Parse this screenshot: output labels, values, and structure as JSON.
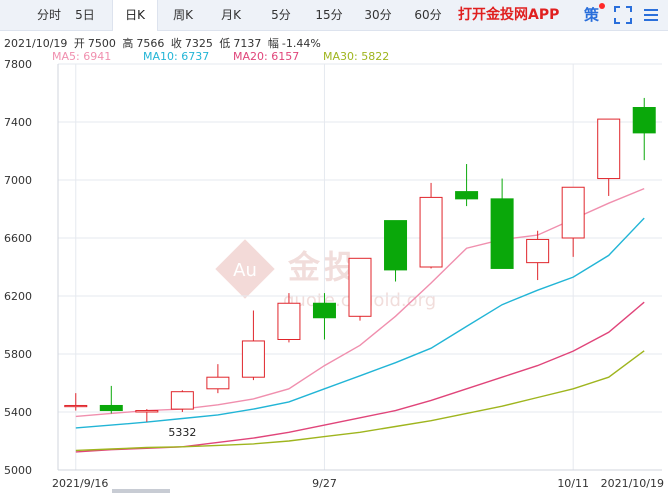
{
  "tabs": [
    {
      "label": "分时",
      "active": false
    },
    {
      "label": "5日",
      "active": false
    },
    {
      "label": "日K",
      "active": true
    },
    {
      "label": "周K",
      "active": false
    },
    {
      "label": "月K",
      "active": false
    },
    {
      "label": "5分",
      "active": false
    },
    {
      "label": "15分",
      "active": false
    },
    {
      "label": "30分",
      "active": false
    },
    {
      "label": "60分",
      "active": false
    }
  ],
  "app_link": "打开金投网APP",
  "strategy_icon_text": "策",
  "info": {
    "date": "2021/10/19",
    "open_label": "开",
    "open": "7500",
    "high_label": "高",
    "high": "7566",
    "close_label": "收",
    "close": "7325",
    "low_label": "低",
    "low": "7137",
    "change_label": "幅",
    "change": "-1.44%"
  },
  "ma_labels": [
    {
      "text": "MA5: 6941",
      "color": "#f08fae"
    },
    {
      "text": "MA10: 6737",
      "color": "#22b5d6"
    },
    {
      "text": "MA20: 6157",
      "color": "#e0457a"
    },
    {
      "text": "MA30: 5822",
      "color": "#9fb51e"
    }
  ],
  "watermark": {
    "brand": "金投",
    "logo_text": "Au",
    "url": "quote.cngold.org"
  },
  "colors": {
    "up": "#e0252b",
    "down": "#0aa80a",
    "grid": "#e6e9ef"
  },
  "chart_data": {
    "type": "candlestick",
    "ylim": [
      5000,
      7800
    ],
    "yticks": [
      5000,
      5400,
      5800,
      6200,
      6600,
      7000,
      7400,
      7800
    ],
    "xtick_labels": [
      {
        "index": 0,
        "label": "2021/9/16"
      },
      {
        "index": 7,
        "label": "9/27"
      },
      {
        "index": 14,
        "label": "10/11"
      },
      {
        "index": 21,
        "label": "2021/10/19"
      }
    ],
    "annotations": [
      {
        "index": 3,
        "value": 5332,
        "label": "5332",
        "position": "below"
      },
      {
        "index": 22,
        "value": 7566,
        "label": "7566",
        "position": "above"
      }
    ],
    "candles": [
      {
        "open": 5440,
        "high": 5530,
        "low": 5410,
        "close": 5445
      },
      {
        "open": 5445,
        "high": 5580,
        "low": 5390,
        "close": 5410
      },
      {
        "open": 5400,
        "high": 5420,
        "low": 5332,
        "close": 5410
      },
      {
        "open": 5420,
        "high": 5550,
        "low": 5400,
        "close": 5540
      },
      {
        "open": 5560,
        "high": 5730,
        "low": 5530,
        "close": 5640
      },
      {
        "open": 5640,
        "high": 6100,
        "low": 5620,
        "close": 5890
      },
      {
        "open": 5900,
        "high": 6220,
        "low": 5880,
        "close": 6150
      },
      {
        "open": 6150,
        "high": 6220,
        "low": 5900,
        "close": 6050
      },
      {
        "open": 6060,
        "high": 6460,
        "low": 6030,
        "close": 6460
      },
      {
        "open": 6720,
        "high": 6720,
        "low": 6300,
        "close": 6380
      },
      {
        "open": 6400,
        "high": 6980,
        "low": 6390,
        "close": 6880
      },
      {
        "open": 6920,
        "high": 7110,
        "low": 6820,
        "close": 6870
      },
      {
        "open": 6870,
        "high": 7010,
        "low": 6390,
        "close": 6390
      },
      {
        "open": 6430,
        "high": 6650,
        "low": 6310,
        "close": 6590
      },
      {
        "open": 6600,
        "high": 6950,
        "low": 6470,
        "close": 6950
      },
      {
        "open": 7010,
        "high": 7420,
        "low": 6890,
        "close": 7420
      },
      {
        "open": 7500,
        "high": 7566,
        "low": 7137,
        "close": 7325
      }
    ],
    "series": [
      {
        "name": "MA5",
        "color": "#f08fae",
        "values": [
          5370,
          5390,
          5410,
          5420,
          5450,
          5490,
          5560,
          5720,
          5860,
          6060,
          6290,
          6530,
          6590,
          6620,
          6730,
          6840,
          6941
        ]
      },
      {
        "name": "MA10",
        "color": "#22b5d6",
        "values": [
          5290,
          5310,
          5330,
          5355,
          5380,
          5420,
          5470,
          5560,
          5650,
          5740,
          5840,
          5990,
          6140,
          6240,
          6330,
          6480,
          6737
        ]
      },
      {
        "name": "MA20",
        "color": "#e0457a",
        "values": [
          5125,
          5140,
          5150,
          5160,
          5190,
          5220,
          5260,
          5310,
          5360,
          5410,
          5480,
          5560,
          5640,
          5720,
          5820,
          5950,
          6157
        ]
      },
      {
        "name": "MA30",
        "color": "#9fb51e",
        "values": [
          5135,
          5145,
          5155,
          5160,
          5170,
          5180,
          5200,
          5230,
          5260,
          5300,
          5340,
          5390,
          5440,
          5500,
          5560,
          5640,
          5822
        ]
      }
    ]
  }
}
